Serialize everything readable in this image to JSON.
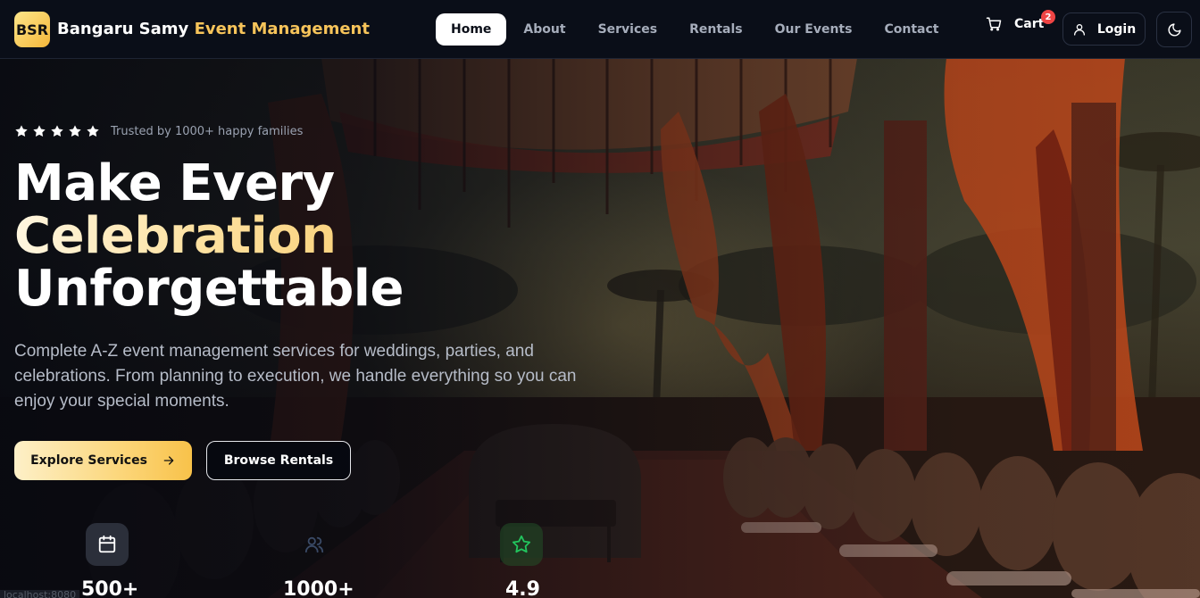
{
  "header": {
    "logo_text": "BSR",
    "brand_part1": "Bangaru Samy",
    "brand_part2": "Event Management",
    "nav": [
      {
        "label": "Home",
        "active": true
      },
      {
        "label": "About",
        "active": false
      },
      {
        "label": "Services",
        "active": false
      },
      {
        "label": "Rentals",
        "active": false
      },
      {
        "label": "Our Events",
        "active": false
      },
      {
        "label": "Contact",
        "active": false
      }
    ],
    "cart_label": "Cart",
    "cart_count": "2",
    "login_label": "Login",
    "icons": {
      "cart": "shopping-cart-icon",
      "login": "user-icon",
      "theme": "moon-icon"
    }
  },
  "hero": {
    "rating_stars": 5,
    "trust_text": "Trusted by 1000+ happy families",
    "headline_line1": "Make Every",
    "headline_line2": "Celebration",
    "headline_line3": "Unforgettable",
    "description": "Complete A-Z event management services for weddings, parties, and celebrations. From planning to execution, we handle everything so you can enjoy your special moments.",
    "primary_button": "Explore Services",
    "secondary_button": "Browse Rentals"
  },
  "stats": [
    {
      "value": "500+",
      "icon": "calendar-icon"
    },
    {
      "value": "1000+",
      "icon": "users-icon"
    },
    {
      "value": "4.9",
      "icon": "star-icon"
    }
  ],
  "status_bar_hint": "localhost:8080",
  "colors": {
    "accent": "#f7c45a",
    "background": "#0b0f19",
    "badge": "#ef4444",
    "rating_icon": "#22c55e"
  }
}
